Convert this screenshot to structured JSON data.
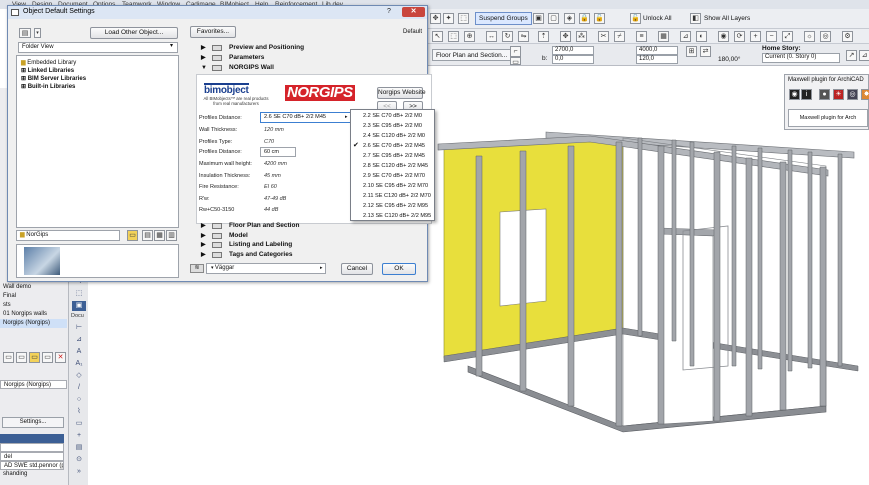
{
  "menubar": {
    "items": [
      "View",
      "Design",
      "Document",
      "Options",
      "Teamwork",
      "Window",
      "Cadimage",
      "BIMobject",
      "Help",
      "Reinforcement",
      "Lib dev"
    ]
  },
  "toolbar": {
    "suspend_groups": "Suspend Groups",
    "unlock_all": "Unlock All",
    "show_all_layers": "Show All Layers"
  },
  "infobox": {
    "tab_floor_plan": "Floor Plan and Section...",
    "val_top": "2700,0",
    "val_b": "0,0",
    "val_width": "4000,0",
    "val_thickness": "120,0",
    "val_angle": "180,00°",
    "home_story_label": "Home Story:",
    "home_story_value": "Current (0. Story 0)"
  },
  "maxwell": {
    "title": "Maxwell plugin for ArchiCAD",
    "button": "Maxwell plugin for Arch"
  },
  "navigator": {
    "wall_demo": "Wall demo",
    "final": "Final",
    "sts": "sts",
    "walls": "01 Norgips walls",
    "selected": "Norgips (Norgips)",
    "item_norgips": "Norgips (Norgips)",
    "settings": "Settings...",
    "del": "del",
    "wall_std": "AD SWE std.pennor (p...",
    "shanding": "shanding"
  },
  "toolbox": {
    "docu_label": "Docu"
  },
  "dialog": {
    "title": "Object Default Settings",
    "load_other": "Load Other Object...",
    "folder_view": "Folder View",
    "favorites": "Favorites...",
    "default_label": "Default",
    "tree": [
      "Embedded Library",
      "Linked Libraries",
      "BIM Server Libraries",
      "Built-in Libraries"
    ],
    "folder_name": "NorGips",
    "sections": {
      "preview": "Preview and Positioning",
      "parameters": "Parameters",
      "norgips_wall": "NORGIPS Wall",
      "floor_plan": "Floor Plan and Section",
      "model": "Model",
      "listing": "Listing and Labeling",
      "tags": "Tags and Categories"
    },
    "bimobject_logo": "bimobject",
    "bimobject_tagline": "All BIMobjects™ are real products from real manufacturers",
    "norgips_logo": "NORGIPS",
    "norgips_website": "Norgips Website",
    "nav_prev": "<<",
    "nav_next": ">>",
    "props": [
      {
        "label": "Profiles Distance:",
        "value": "2.6  SE C70  dB+ 2/2 M45"
      },
      {
        "label": "Wall Thickness:",
        "value": "120 mm"
      },
      {
        "label": "Profiles Type:",
        "value": "C70"
      },
      {
        "label": "Profiles Distance:",
        "value": "60 cm"
      },
      {
        "label": "Maximum wall height:",
        "value": "4200 mm"
      },
      {
        "label": "Insulation Thickness:",
        "value": "45 mm"
      },
      {
        "label": "Fire Resistance:",
        "value": "EI 60"
      },
      {
        "label": "R'w:",
        "value": "47-49 dB"
      },
      {
        "label": "Rw+C50-3150",
        "value": "44 dB"
      }
    ],
    "layer": "Väggar",
    "cancel": "Cancel",
    "ok": "OK"
  },
  "dropdown": {
    "selected_index": 3,
    "items": [
      "2.2  SE C70  dB+ 2/2 M0",
      "2.3  SE C95  dB+ 2/2 M0",
      "2.4  SE C120  dB+ 2/2 M0",
      "2.6  SE C70  dB+ 2/2 M45",
      "2.7  SE C95  dB+ 2/2 M45",
      "2.8  SE C120  dB+ 2/2 M45",
      "2.9  SE C70  dB+ 2/2 M70",
      "2.10  SE C95  dB+ 2/2 M70",
      "2.11  SE C120  dB+ 2/2 M70",
      "2.12  SE C95  dB+ 2/2 M95",
      "2.13  SE C120  dB+ 2/2 M95"
    ]
  },
  "colors": {
    "accent": "#3c7fd1",
    "insulation": "#e8df3c",
    "studs": "#9b9ea3",
    "close": "#c9463d"
  }
}
